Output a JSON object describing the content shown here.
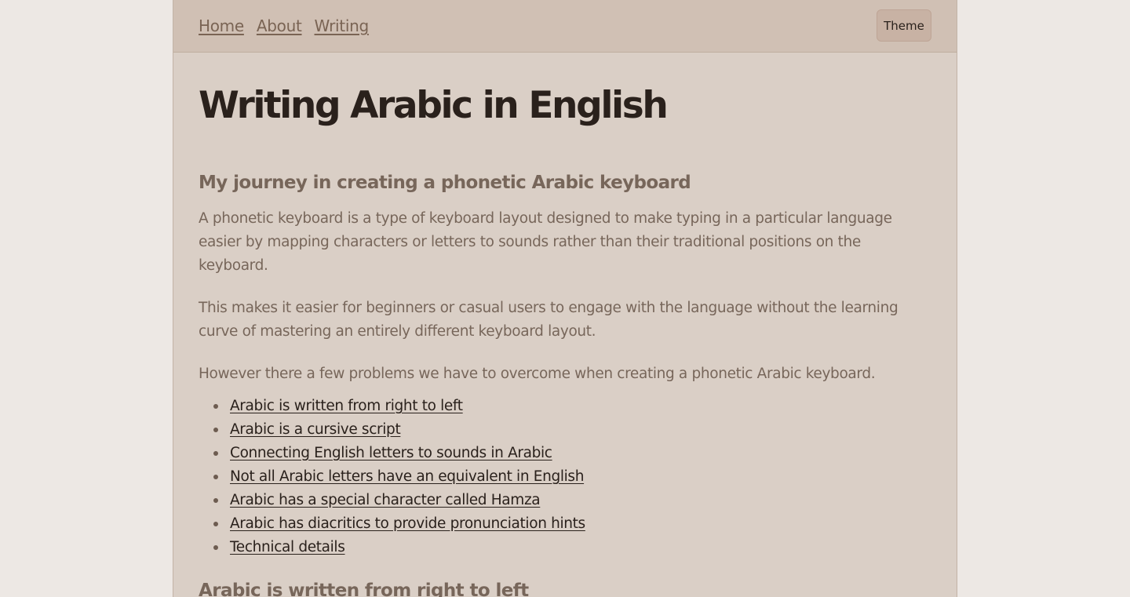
{
  "nav": {
    "items": [
      {
        "label": "Home"
      },
      {
        "label": "About"
      },
      {
        "label": "Writing"
      }
    ],
    "theme_label": "Theme"
  },
  "article": {
    "title": "Writing Arabic in English",
    "subtitle": "My journey in creating a phonetic Arabic keyboard",
    "paragraphs": [
      "A phonetic keyboard is a type of keyboard layout designed to make typing in a particular language easier by mapping characters or letters to sounds rather than their traditional positions on the keyboard.",
      "This makes it easier for beginners or casual users to engage with the language without the learning curve of mastering an entirely different keyboard layout.",
      "However there a few problems we have to overcome when creating a phonetic Arabic keyboard."
    ],
    "toc": [
      "Arabic is written from right to left",
      "Arabic is a cursive script",
      "Connecting English letters to sounds in Arabic",
      "Not all Arabic letters have an equivalent in English",
      "Arabic has a special character called Hamza",
      "Arabic has diacritics to provide pronunciation hints",
      "Technical details"
    ],
    "next_section_heading": "Arabic is written from right to left"
  },
  "colors": {
    "outer_background": "#ede8e4",
    "page_background": "#dacfc6",
    "header_background": "#d0c0b4",
    "heading_text": "#2a211c",
    "body_text": "#77665a",
    "nav_link": "#7a6454"
  }
}
